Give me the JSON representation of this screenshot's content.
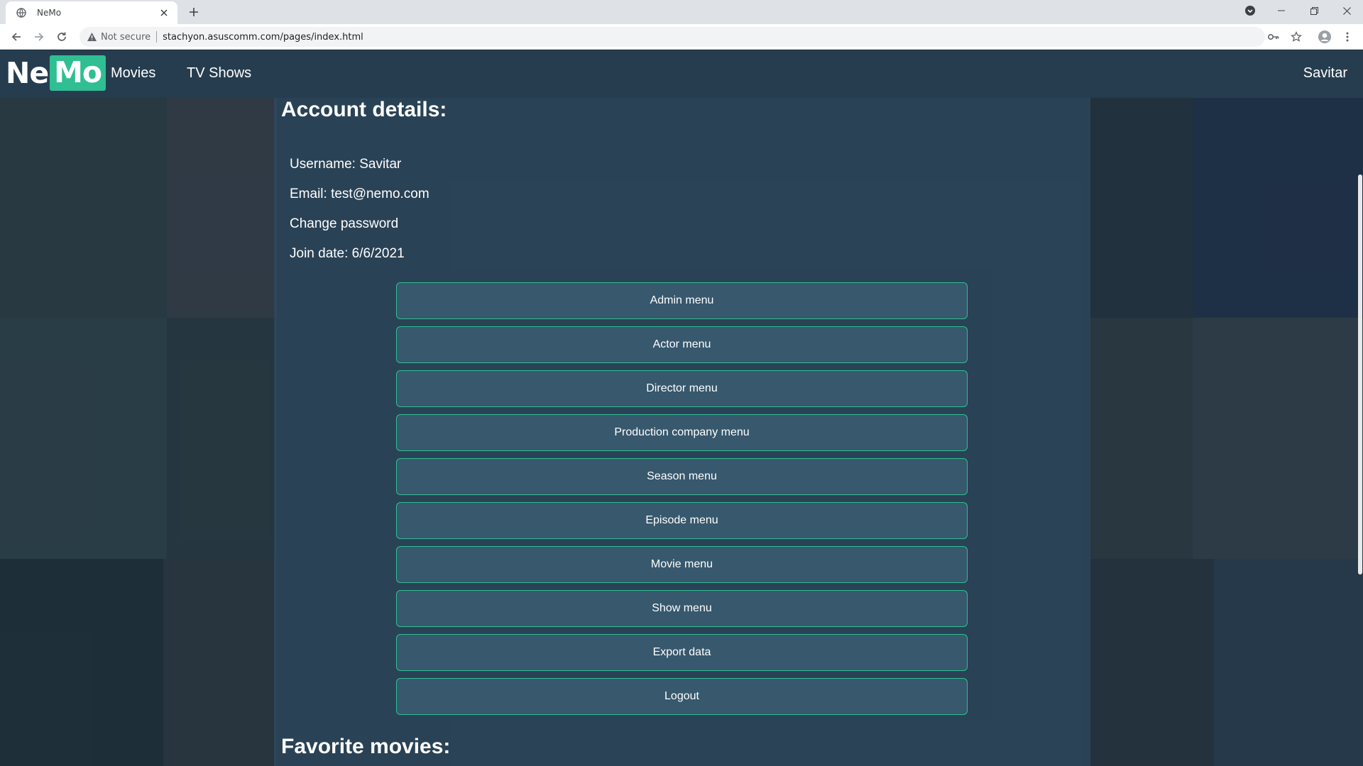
{
  "browser": {
    "tab_title": "NeMo",
    "address": {
      "security_label": "Not secure",
      "url": "stachyon.asuscomm.com/pages/index.html"
    }
  },
  "nav": {
    "logo": {
      "part1": "Ne",
      "part2": "Mo"
    },
    "links": [
      "Movies",
      "TV Shows"
    ],
    "user": "Savitar"
  },
  "account": {
    "title": "Account details:",
    "username_line": "Username: Savitar",
    "email_line": "Email: test@nemo.com",
    "change_password": "Change password",
    "join_date_line": "Join date: 6/6/2021"
  },
  "menu": [
    "Admin menu",
    "Actor menu",
    "Director menu",
    "Production company menu",
    "Season menu",
    "Episode menu",
    "Movie menu",
    "Show menu",
    "Export data",
    "Logout"
  ],
  "favorites": {
    "title": "Favorite movies:"
  },
  "colors": {
    "accent": "#2fbf93",
    "panel": "#2c465a",
    "navbar": "#263e50"
  }
}
